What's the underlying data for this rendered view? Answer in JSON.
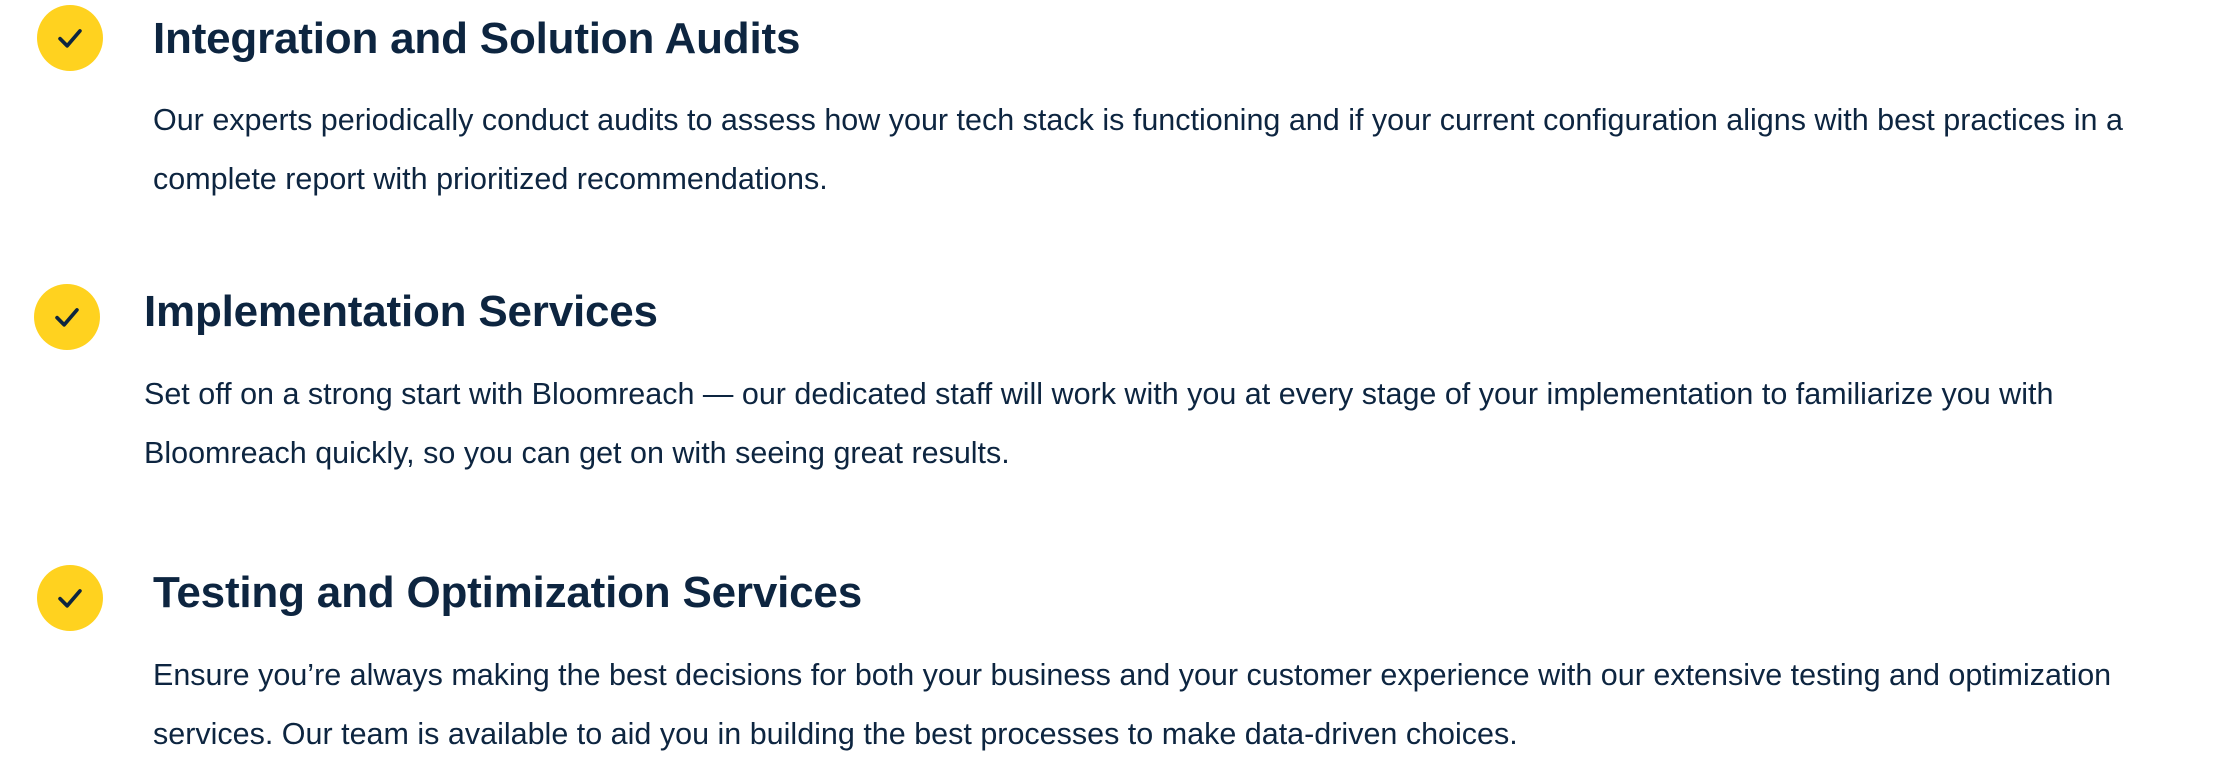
{
  "colors": {
    "accent": "#ffd21f",
    "text": "#0d2540",
    "background": "#ffffff"
  },
  "services": [
    {
      "icon": "check-circle-icon",
      "title": "Integration and Solution Audits",
      "description": "Our experts periodically conduct audits to assess how your tech stack is functioning and if your current configuration aligns with best practices in a complete report with prioritized recommendations."
    },
    {
      "icon": "check-circle-icon",
      "title": "Implementation Services",
      "description": "Set off on a strong start with Bloomreach — our dedicated staff will work with you at every stage of your implementation to familiarize you with Bloomreach quickly, so you can get on with seeing great results."
    },
    {
      "icon": "check-circle-icon",
      "title": "Testing and Optimization Services",
      "description": "Ensure you’re always making the best decisions for both your business and your customer experience with our extensive testing and optimization services. Our team is available to aid you in building the best processes to make data-driven choices."
    }
  ]
}
